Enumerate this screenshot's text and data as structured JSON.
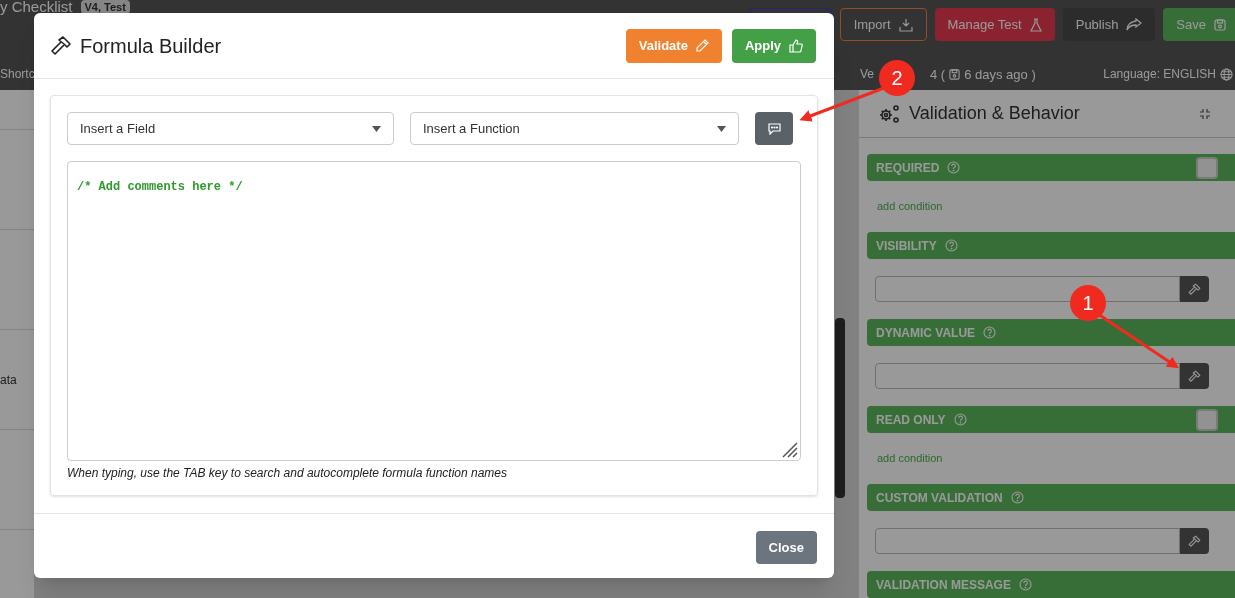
{
  "background": {
    "title": "y Checklist",
    "badge": "V4, Test",
    "toolbar_buttons": [
      {
        "kind": "outline-blue"
      },
      {
        "label": "Import",
        "kind": "outline-orange"
      },
      {
        "label": "Manage Test",
        "kind": "danger"
      },
      {
        "label": "Publish",
        "kind": "dark"
      },
      {
        "label": "Save",
        "kind": "success"
      }
    ],
    "shortcut_label": "Shortc",
    "left_row_label": "ata",
    "version_start": "Ve",
    "version_end": "4 (",
    "saved_ago": "6 days ago )",
    "language": "Language: ENGLISH"
  },
  "side_panel": {
    "title": "Validation & Behavior",
    "sections": [
      {
        "label": "REQUIRED",
        "kind": "toggle",
        "checked": false,
        "link": "add condition"
      },
      {
        "label": "VISIBILITY",
        "kind": "formula"
      },
      {
        "label": "DYNAMIC VALUE",
        "kind": "formula"
      },
      {
        "label": "READ ONLY",
        "kind": "toggle",
        "checked": false,
        "link": "add condition"
      },
      {
        "label": "CUSTOM VALIDATION",
        "kind": "formula"
      },
      {
        "label": "VALIDATION MESSAGE",
        "kind": "header"
      }
    ]
  },
  "dialog": {
    "title": "Formula Builder",
    "validate": "Validate",
    "apply": "Apply",
    "field_select": "Insert a Field",
    "function_select": "Insert a Function",
    "editor_text": "/* Add comments here */",
    "hint": "When typing, use the TAB key to search and autocomplete formula function names",
    "close": "Close"
  },
  "annotations": [
    {
      "label": "1"
    },
    {
      "label": "2"
    }
  ]
}
